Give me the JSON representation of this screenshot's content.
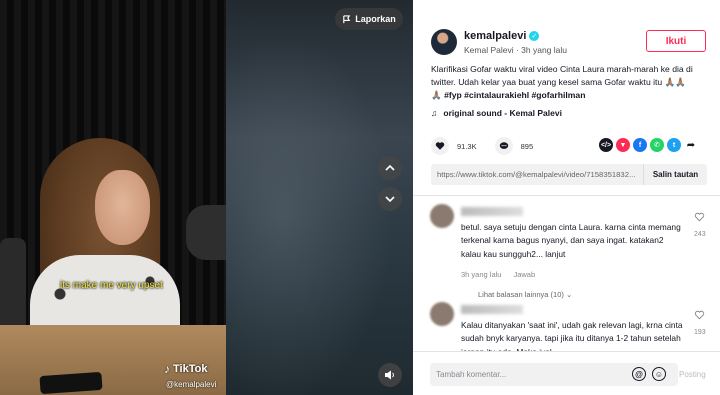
{
  "video": {
    "subtitle": "its make me very upset",
    "watermark_brand": "TikTok",
    "watermark_handle": "@kemalpalevi",
    "report_label": "Laporkan"
  },
  "post": {
    "author_username": "kemalpalevi",
    "author_display": "Kemal Palevi · 3h yang lalu",
    "follow_label": "Ikuti",
    "caption": "Klarifikasi Gofar waktu viral video Cinta Laura marah-marah ke dia di twitter. Udah kelar yaa buat yang kesel sama Gofar waktu itu 🙏🏽🙏🏽",
    "caption_tags": "🙏🏽 #fyp #cintalaurakiehl #gofarhilman",
    "music": "original sound - Kemal Palevi",
    "likes": "91.3K",
    "comments_count": "895",
    "link": "https://www.tiktok.com/@kemalpalevi/video/7158351832...",
    "copy_link_label": "Salin tautan"
  },
  "comments": [
    {
      "text": "betul. saya setuju dengan cinta Laura. karna cinta memang terkenal karna bagus nyanyi, dan saya ingat. katakan2 kalau kau sungguh2... lanjut",
      "time": "3h yang lalu",
      "reply_label": "Jawab",
      "likes": "243",
      "more_replies": "Lihat balasan lainnya (10)"
    },
    {
      "text": "Kalau ditanyakan 'saat ini', udah gak relevan lagi, krna cinta sudah bnyk karyanya. tapi jika itu ditanya 1-2 tahun setelah jargon itu ada. Maka iyal",
      "likes": "193"
    }
  ],
  "composer": {
    "placeholder": "Tambah komentar...",
    "post_label": "Posting"
  },
  "colors": {
    "accent": "#fe2c55",
    "verified": "#20d5ec"
  }
}
